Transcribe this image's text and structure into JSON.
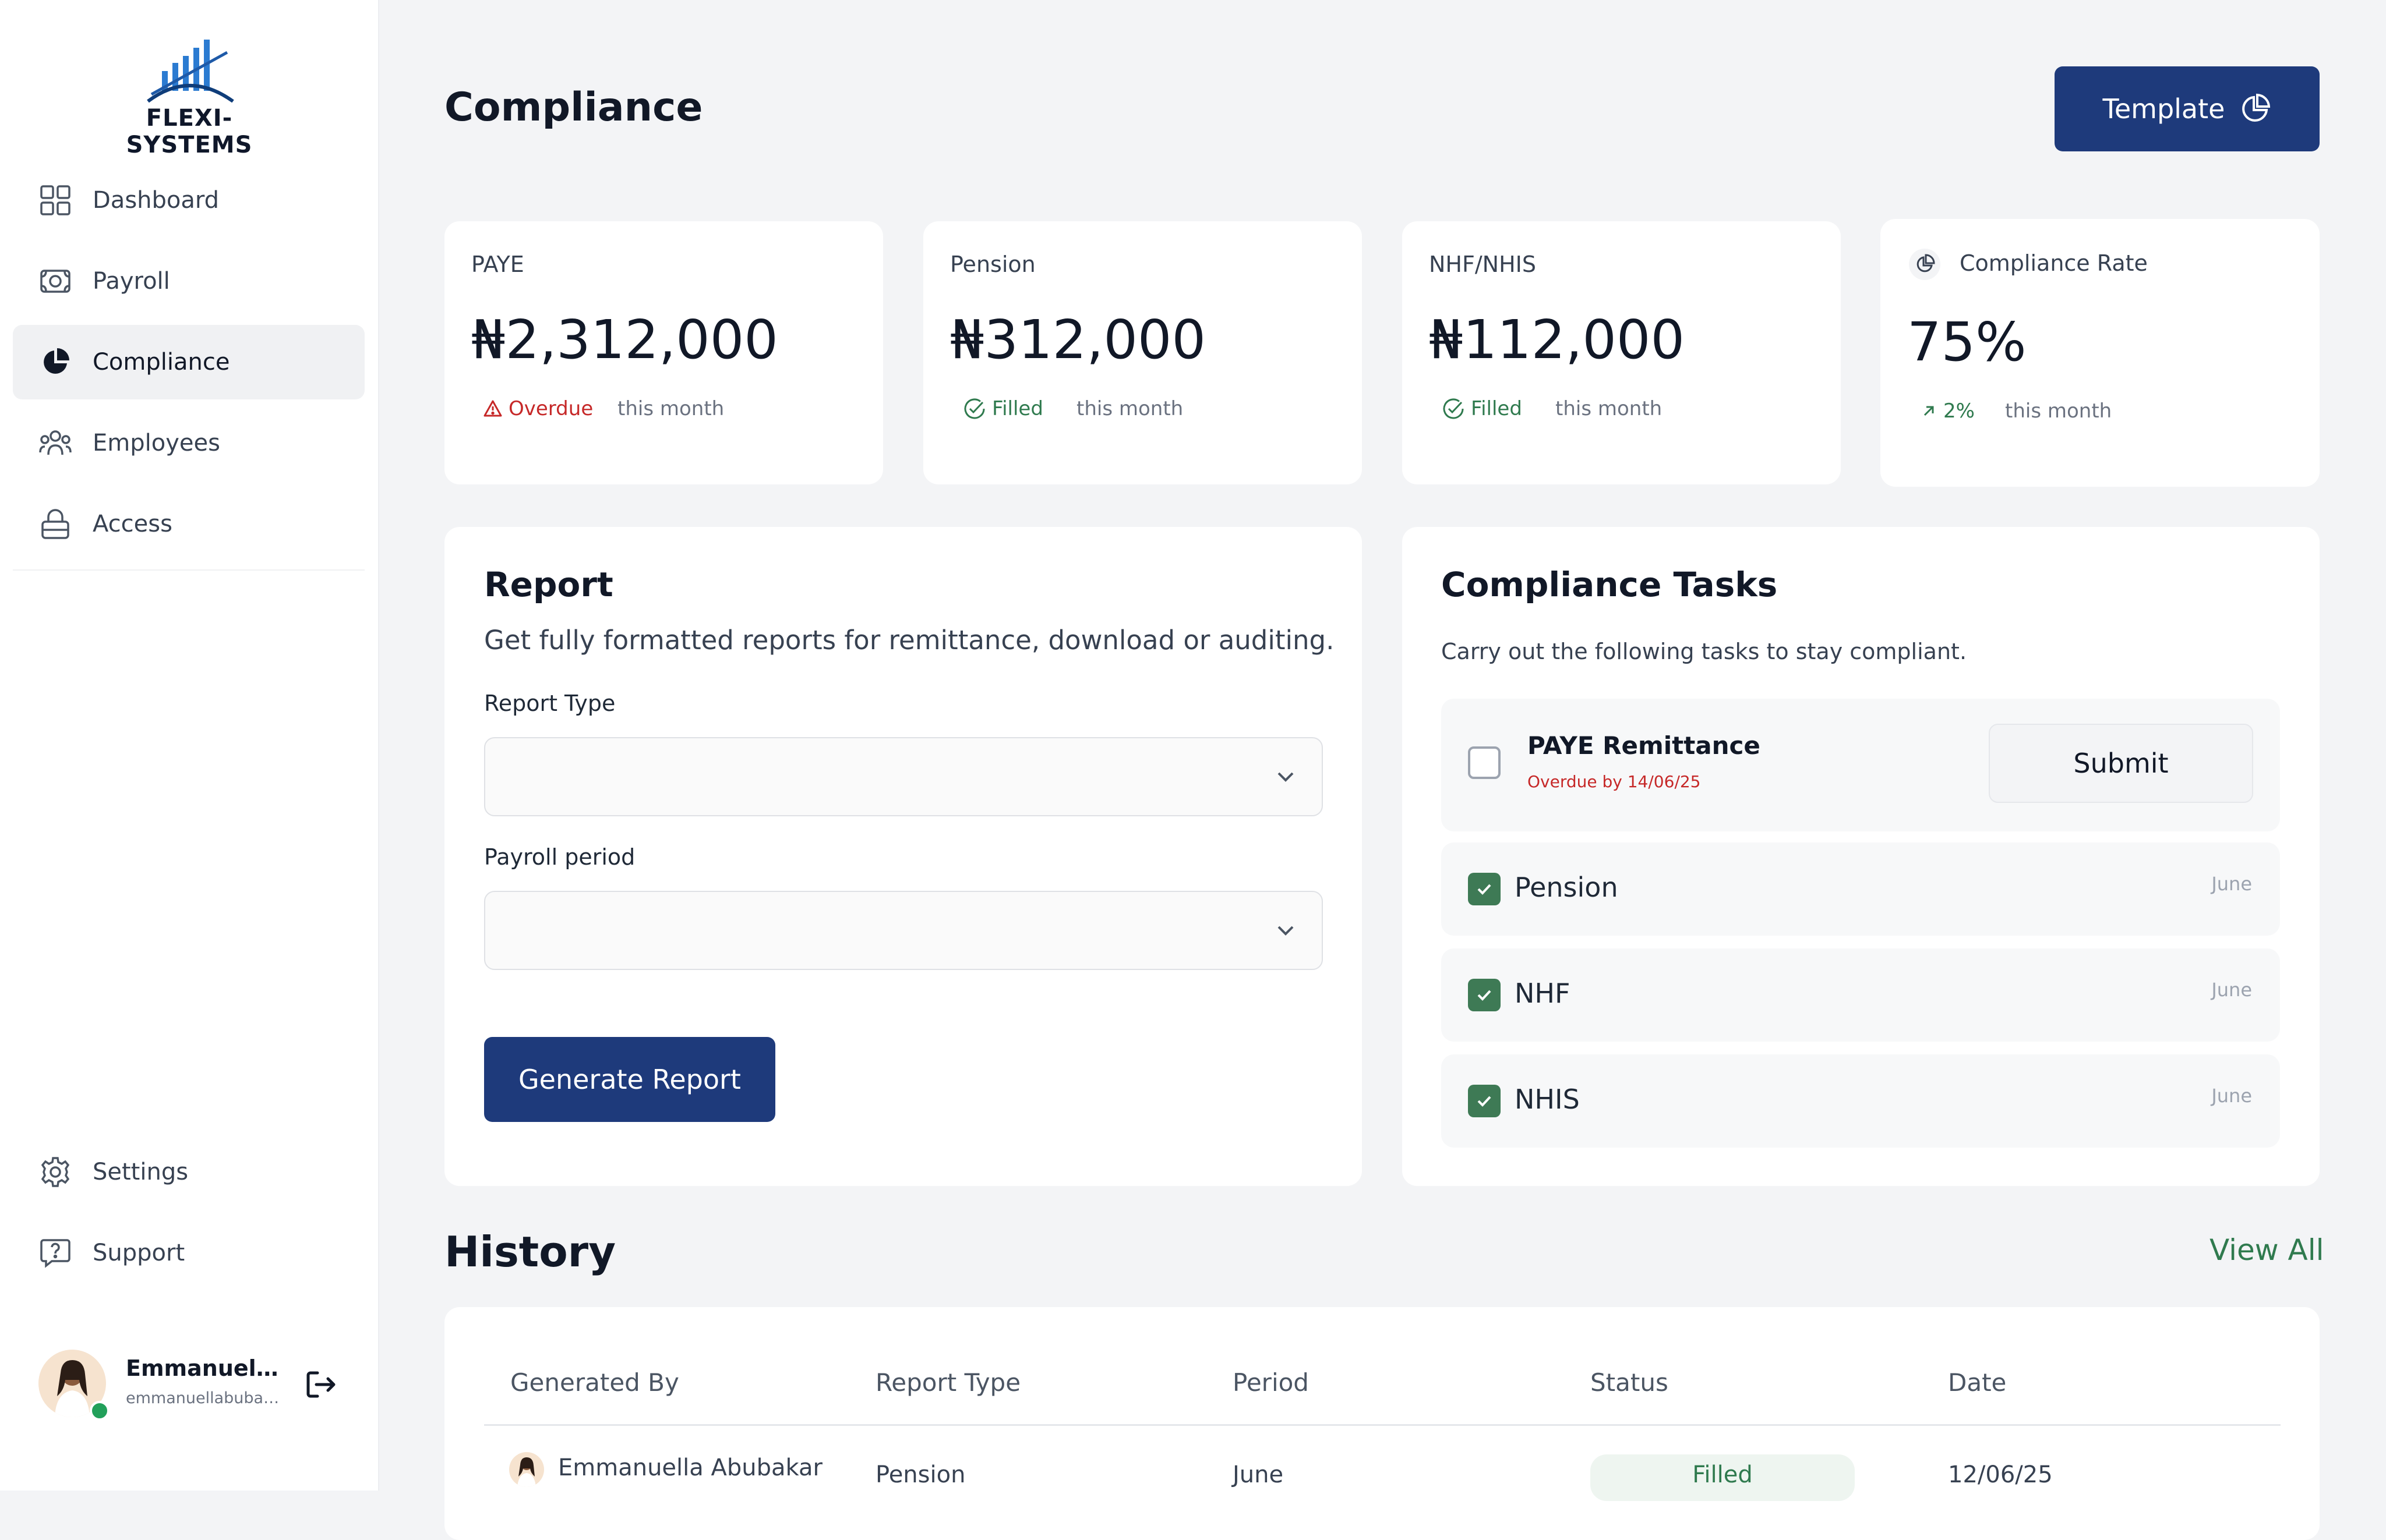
{
  "brand": {
    "name": "FLEXI-SYSTEMS",
    "logo_color": "#2b7bd1"
  },
  "sidebar": {
    "items": [
      {
        "label": "Dashboard",
        "icon": "grid-icon"
      },
      {
        "label": "Payroll",
        "icon": "money-icon"
      },
      {
        "label": "Compliance",
        "icon": "pie-chart-icon",
        "active": true
      },
      {
        "label": "Employees",
        "icon": "people-icon"
      },
      {
        "label": "Access",
        "icon": "lock-icon"
      }
    ],
    "bottom_items": [
      {
        "label": "Settings",
        "icon": "gear-icon"
      },
      {
        "label": "Support",
        "icon": "help-chat-icon"
      }
    ],
    "user": {
      "name": "Emmanuella...",
      "email": "emmanuellabubak..."
    }
  },
  "header": {
    "title": "Compliance",
    "template_button": "Template"
  },
  "stats": [
    {
      "label": "PAYE",
      "value": "₦2,312,000",
      "badge": "Overdue",
      "badge_status": "overdue",
      "footnote": "this month"
    },
    {
      "label": "Pension",
      "value": "₦312,000",
      "badge": "Filled",
      "badge_status": "filled",
      "footnote": "this month"
    },
    {
      "label": "NHF/NHIS",
      "value": "₦112,000",
      "badge": "Filled",
      "badge_status": "filled",
      "footnote": "this month"
    },
    {
      "label": "Compliance Rate",
      "value": "75%",
      "badge": "2%",
      "badge_status": "up",
      "footnote": "this month"
    }
  ],
  "report": {
    "title": "Report",
    "subtitle": "Get fully formatted reports for remittance, download or auditing.",
    "report_type_label": "Report Type",
    "report_type_value": "",
    "payroll_period_label": "Payroll period",
    "payroll_period_value": "",
    "generate_button": "Generate Report"
  },
  "tasks": {
    "title": "Compliance Tasks",
    "subtitle": "Carry out the following tasks to stay compliant.",
    "items": [
      {
        "name": "PAYE Remittance",
        "note": "Overdue by 14/06/25",
        "checked": false,
        "action": "Submit"
      },
      {
        "name": "Pension",
        "month": "June",
        "checked": true
      },
      {
        "name": "NHF",
        "month": "June",
        "checked": true
      },
      {
        "name": "NHIS",
        "month": "June",
        "checked": true
      }
    ]
  },
  "history": {
    "title": "History",
    "view_all": "View All",
    "columns": [
      "Generated By",
      "Report Type",
      "Period",
      "Status",
      "Date"
    ],
    "rows": [
      {
        "generated_by": "Emmanuella Abubakar",
        "report_type": "Pension",
        "period": "June",
        "status": "Filled",
        "date": "12/06/25"
      }
    ]
  },
  "colors": {
    "primary": "#1e3a7b",
    "success": "#2f7a4e",
    "danger": "#c62828",
    "checkbox": "#3e7a55"
  }
}
